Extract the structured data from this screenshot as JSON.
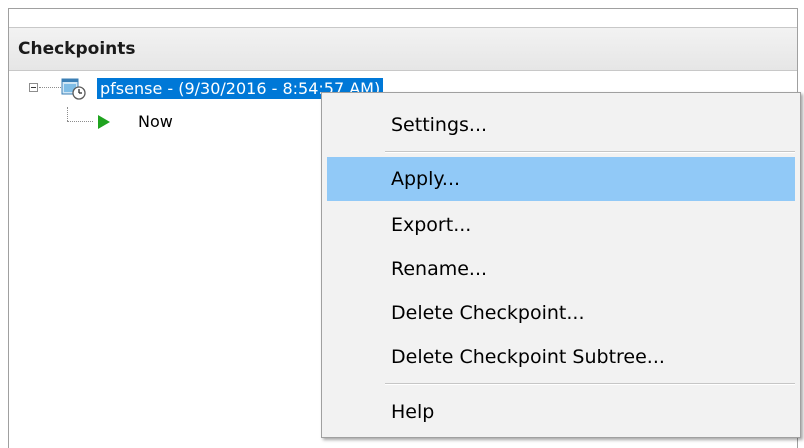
{
  "panel": {
    "title": "Checkpoints"
  },
  "tree": {
    "root": {
      "label": "pfsense - (9/30/2016 - 8:54:57 AM)",
      "icon": "checkpoint-icon",
      "selected": true
    },
    "child": {
      "label": "Now",
      "icon": "play-arrow-icon"
    }
  },
  "context_menu": {
    "items": [
      {
        "label": "Settings..."
      },
      {
        "label": "Apply...",
        "highlighted": true
      },
      {
        "label": "Export..."
      },
      {
        "label": "Rename..."
      },
      {
        "label": "Delete Checkpoint..."
      },
      {
        "label": "Delete Checkpoint Subtree..."
      },
      {
        "label": "Help"
      }
    ]
  },
  "colors": {
    "selection": "#0078d7",
    "menu_highlight": "#91c9f7",
    "play_arrow": "#1fa31f"
  }
}
